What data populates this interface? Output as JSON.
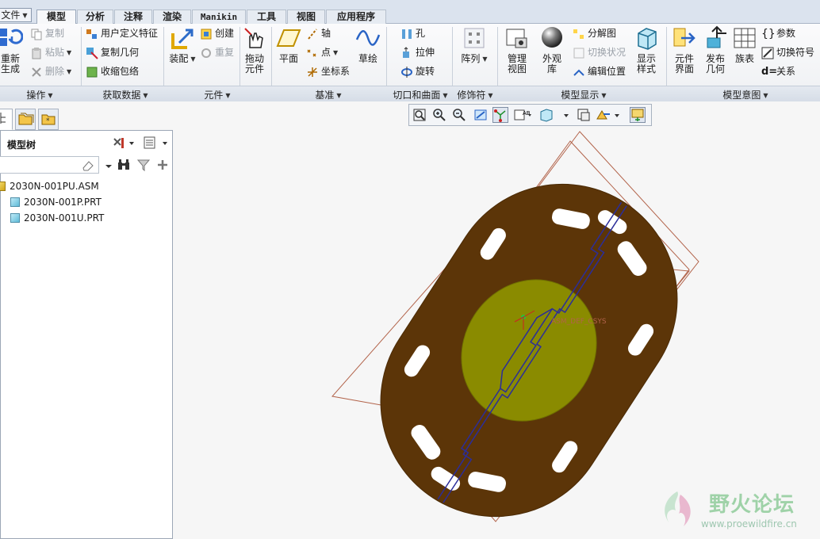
{
  "tabs": [
    {
      "label": "文件",
      "selected": false
    },
    {
      "label": "模型",
      "selected": true
    },
    {
      "label": "分析",
      "selected": false
    },
    {
      "label": "注释",
      "selected": false
    },
    {
      "label": "渲染",
      "selected": false
    },
    {
      "label": "Manikin",
      "selected": false
    },
    {
      "label": "工具",
      "selected": false
    },
    {
      "label": "视图",
      "selected": false
    },
    {
      "label": "应用程序",
      "selected": false
    }
  ],
  "ribbon": {
    "operations": {
      "label": "操作",
      "regenerate": "重新生成",
      "copy": "复制",
      "paste": "粘贴",
      "delete": "删除"
    },
    "get_data": {
      "label": "获取数据",
      "udf": "用户定义特征",
      "copy_geom": "复制几何",
      "shrinkwrap": "收缩包络"
    },
    "component": {
      "label": "元件",
      "assemble": "装配",
      "create": "创建",
      "repeat": "重复",
      "drag": "拖动元件"
    },
    "datum": {
      "label": "基准",
      "plane": "平面",
      "axis": "轴",
      "point": "点",
      "csys": "坐标系",
      "sketch": "草绘"
    },
    "cut_surface": {
      "label": "切口和曲面",
      "hole": "孔",
      "extrude": "拉伸",
      "revolve": "旋转"
    },
    "modifiers": {
      "label": "修饰符",
      "pattern": "阵列"
    },
    "model_display": {
      "label": "模型显示",
      "manage_views": "管理视图",
      "appearance": "外观库",
      "exploded": "分解图",
      "toggle_status": "切换状况",
      "edit_position": "编辑位置",
      "display_style": "显示样式"
    },
    "model_intent": {
      "label": "模型意图",
      "comp_interface": "元件界面",
      "publish_geom": "发布几何",
      "family_table": "族表",
      "parameters": "参数",
      "switch_symbols": "切换符号",
      "relations": "关系"
    }
  },
  "navigator": {
    "title": "模型树",
    "tree": [
      {
        "name": "2030N-001PU.ASM",
        "level": 0
      },
      {
        "name": "2030N-001P.PRT",
        "level": 1
      },
      {
        "name": "2030N-001U.PRT",
        "level": 1
      }
    ]
  },
  "viewport": {
    "csys_label": "ASM_DEF_CSYS"
  },
  "watermark": {
    "title": "野火论坛",
    "url": "www.proewildfire.cn"
  },
  "colors": {
    "part_brown": "#5c3508",
    "part_core": "#8a8b00",
    "datum_line": "#b2634a",
    "ribbon_bg": "#f0f2f5"
  }
}
